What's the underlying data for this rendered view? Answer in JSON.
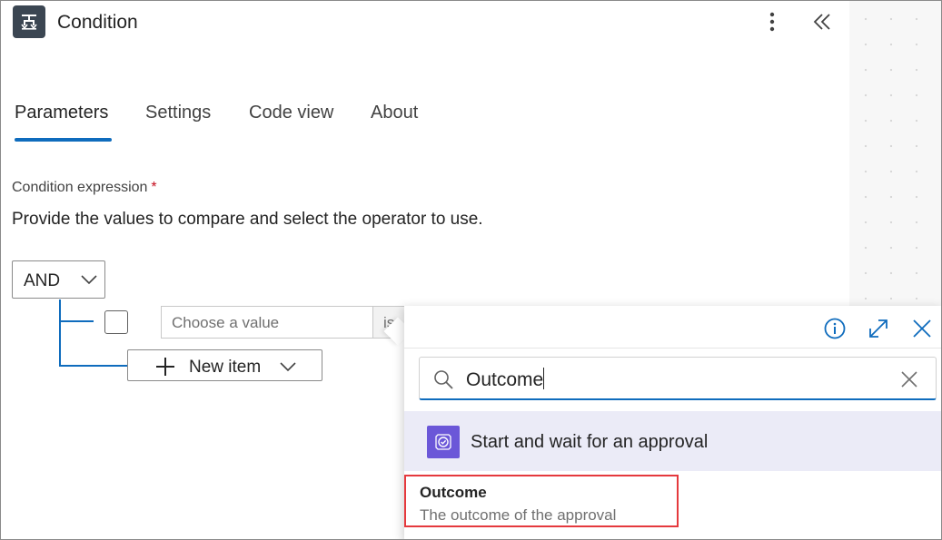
{
  "header": {
    "title": "Condition",
    "icon": "condition-icon",
    "more_icon": "more-vertical-icon",
    "collapse_icon": "double-chevron-left-icon"
  },
  "tabs": [
    {
      "label": "Parameters",
      "active": true
    },
    {
      "label": "Settings",
      "active": false
    },
    {
      "label": "Code view",
      "active": false
    },
    {
      "label": "About",
      "active": false
    }
  ],
  "condition": {
    "label": "Condition expression",
    "required_mark": "*",
    "description": "Provide the values to compare and select the operator to use.",
    "group_operator": "AND",
    "row": {
      "value_placeholder": "Choose a value",
      "operator_text": "is"
    },
    "new_item_label": "New item"
  },
  "dynamic_content": {
    "header_icons": [
      "info-icon",
      "expand-icon",
      "close-icon"
    ],
    "search": {
      "value": "Outcome",
      "placeholder": "Search"
    },
    "group": {
      "title": "Start and wait for an approval",
      "icon": "approval-icon"
    },
    "results": [
      {
        "title": "Outcome",
        "description": "The outcome of the approval",
        "highlighted": true
      }
    ]
  },
  "colors": {
    "accent": "#0f6cbd",
    "approval_icon_bg": "#6b57d8",
    "group_row_bg": "#ebebf7",
    "highlight_border": "#e5393d",
    "required": "#c50f1f"
  }
}
